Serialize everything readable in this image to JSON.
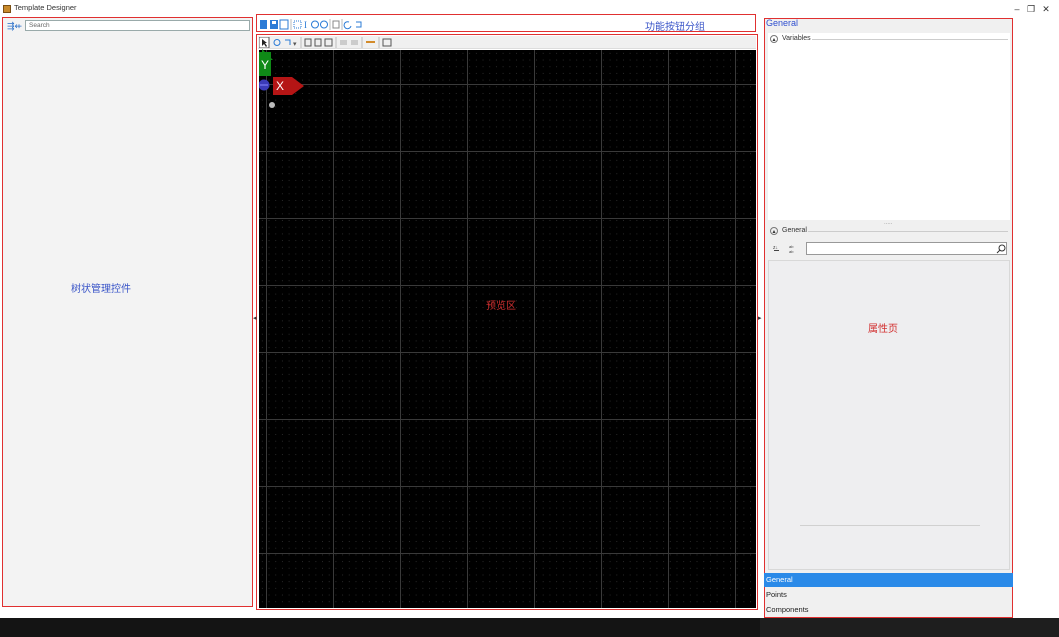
{
  "window": {
    "title": "Template Designer",
    "controls": [
      "–",
      "❐",
      "✕"
    ]
  },
  "left_panel": {
    "search_placeholder": "Search",
    "annotation": "树状管理控件"
  },
  "toolbar": {
    "annotation": "功能按钮分组"
  },
  "preview": {
    "annotation": "预览区",
    "y_axis_label": "Y",
    "x_axis_label": "X"
  },
  "properties": {
    "header": "General",
    "variables_section": "Variables",
    "general_section": "General",
    "annotation": "属性页"
  },
  "bottom_tabs": {
    "general": "General",
    "points": "Points",
    "components": "Components"
  },
  "colors": {
    "annotation_border": "#e03030",
    "annotation_blue": "#3a55c8",
    "annotation_red": "#d23030",
    "accent": "#2a8ae8",
    "canvas": "#000000"
  }
}
